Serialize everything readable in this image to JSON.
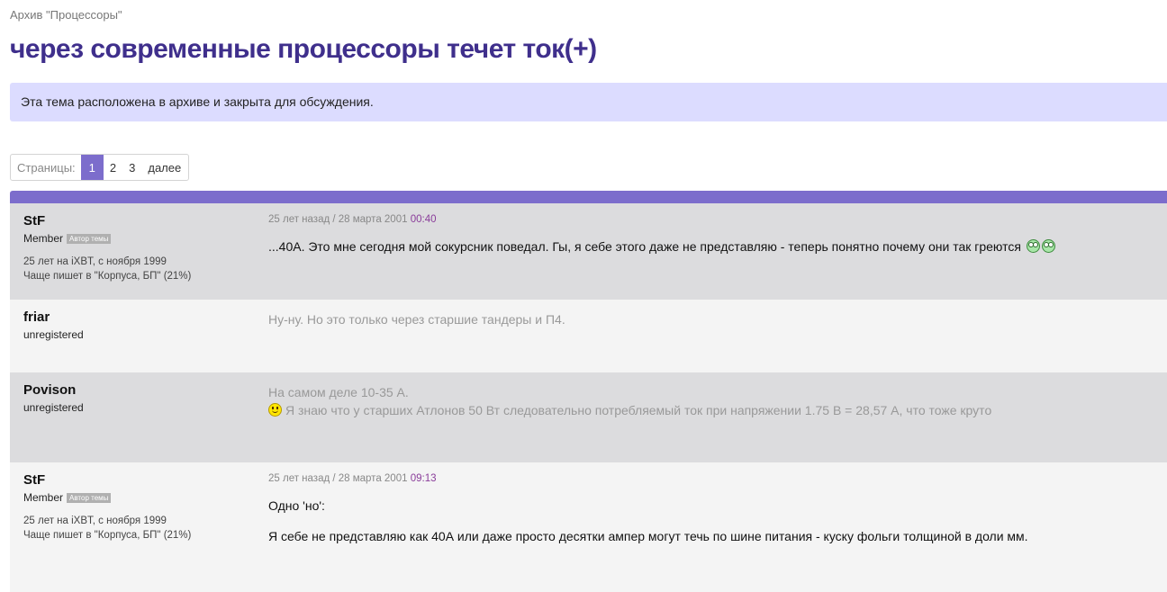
{
  "breadcrumb": "Архив \"Процессоры\"",
  "title": "через современные процессоры течет ток(+)",
  "notice": "Эта тема расположена в архиве и закрыта для обсуждения.",
  "pager": {
    "label": "Страницы:",
    "pages": [
      "1",
      "2",
      "3"
    ],
    "active": "1",
    "next": "далее"
  },
  "colors": {
    "accent": "#7c6dcc",
    "title": "#3f2f8c",
    "notice_bg": "#dcdcff",
    "time": "#8a3d9a"
  },
  "posts": [
    {
      "author": "StF",
      "role": "Member",
      "badge": "Автор темы",
      "member_since": "25 лет на iXBT, с ноября 1999",
      "often_posts": "Чаще пишет в \"Корпуса, БП\" (21%)",
      "date": "25 лет назад / 28 марта 2001",
      "time": "00:40",
      "text": "...40А. Это мне сегодня мой сокурсник поведал. Гы, я себе этого даже не представляю - теперь понятно почему они так греются",
      "smileys": [
        "rolleyes-smiley",
        "rolleyes-smiley"
      ]
    },
    {
      "author": "friar",
      "role": "unregistered",
      "text": "Ну-ну. Но это только через старшие тандеры и П4."
    },
    {
      "author": "Povison",
      "role": "unregistered",
      "text_line1": "На самом деле 10-35 А.",
      "text_line2": "Я знаю что у старших Атлонов 50 Вт следовательно потребляемый ток при напряжении 1.75 В = 28,57 А, что тоже круто",
      "smileys": [
        "smile-smiley"
      ]
    },
    {
      "author": "StF",
      "role": "Member",
      "badge": "Автор темы",
      "member_since": "25 лет на iXBT, с ноября 1999",
      "often_posts": "Чаще пишет в \"Корпуса, БП\" (21%)",
      "date": "25 лет назад / 28 марта 2001",
      "time": "09:13",
      "text_line1": "Одно 'но':",
      "text_line2": "Я себе не представляю как 40А или даже просто десятки ампер могут течь по шине питания - куску фольги толщиной в доли мм."
    }
  ]
}
